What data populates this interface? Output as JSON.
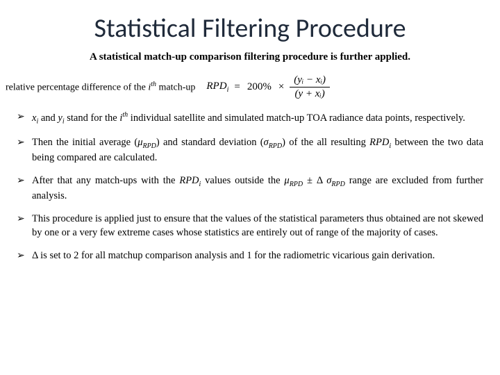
{
  "title": "Statistical Filtering Procedure",
  "subtitle": "A statistical match-up comparison filtering procedure is further applied.",
  "rpd_label_prefix": "relative percentage difference of the ",
  "rpd_label_i": "i",
  "rpd_label_th": "th",
  "rpd_label_suffix": " match-up",
  "formula": {
    "lhs_var": "RPD",
    "lhs_sub": "i",
    "eq": " = ",
    "coef": "200%",
    "times": " × ",
    "num": "(yᵢ − xᵢ)",
    "den": "(y + xᵢ)"
  },
  "bullets": {
    "b1_a": "x",
    "b1_b": "i",
    "b1_c": " and ",
    "b1_d": "y",
    "b1_e": "i",
    "b1_f": " stand for the ",
    "b1_g": "i",
    "b1_h": "th",
    "b1_i": " individual satellite and simulated match-up TOA radiance data points, respectively.",
    "b2_a": "Then the initial average (",
    "b2_b": "μ",
    "b2_c": "RPD",
    "b2_d": ") and standard deviation (",
    "b2_e": "σ",
    "b2_f": "RPD",
    "b2_g": ") of the all resulting ",
    "b2_h": "RPD",
    "b2_i": "i",
    "b2_j": " between the two data being compared are calculated.",
    "b3_a": "After that any match-ups with the ",
    "b3_b": "RPD",
    "b3_c": "i",
    "b3_d": " values outside the ",
    "b3_e": "μ",
    "b3_f": "RPD",
    "b3_g": " ± Δ ",
    "b3_h": "σ",
    "b3_i": "RPD",
    "b3_j": " range are excluded from further analysis.",
    "b4": "This procedure is applied just to ensure that the values of the statistical parameters thus obtained are not skewed by one or a very few extreme cases whose statistics are entirely out of range of the majority of cases.",
    "b5": "Δ is set to 2 for all matchup comparison analysis and 1 for the radiometric vicarious gain derivation."
  }
}
